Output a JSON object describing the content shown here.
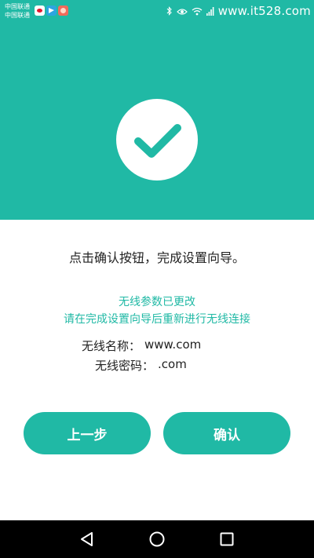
{
  "status_bar": {
    "carrier_1": "中国联通",
    "carrier_2": "中国联通",
    "notification_icons": [
      "weibo-icon",
      "telegram-icon",
      "app-icon"
    ],
    "system_icons": [
      "bluetooth-icon",
      "eye-icon",
      "wifi-icon",
      "signal-icon"
    ],
    "watermark": "www.it528.com"
  },
  "header": {
    "icon": "checkmark-icon",
    "background_color": "#20b9a5"
  },
  "main": {
    "instruction": "点击确认按钮，完成设置向导。",
    "notice_line_1": "无线参数已更改",
    "notice_line_2": "请在完成设置向导后重新进行无线连接",
    "ssid_label": "无线名称：",
    "ssid_value": "www.com",
    "password_label": "无线密码：",
    "password_value": ".com"
  },
  "buttons": {
    "prev_label": "上一步",
    "confirm_label": "确认"
  },
  "nav_bar": {
    "back_icon": "back-triangle-icon",
    "home_icon": "home-circle-icon",
    "recent_icon": "recent-square-icon"
  }
}
